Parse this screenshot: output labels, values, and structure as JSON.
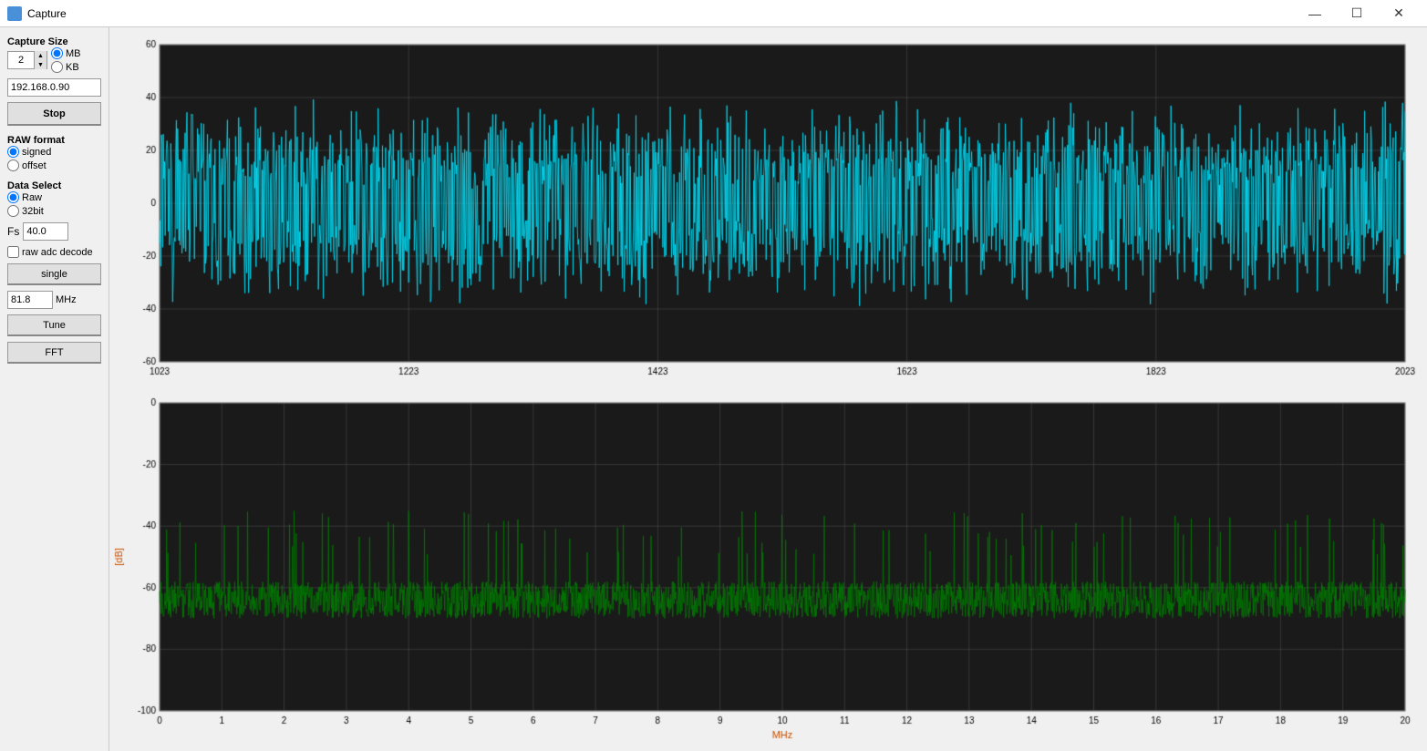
{
  "titleBar": {
    "title": "Capture",
    "icon": "capture-icon",
    "controls": {
      "minimize": "—",
      "maximize": "☐",
      "close": "✕"
    }
  },
  "sidebar": {
    "captureSizeLabel": "Capture Size",
    "captureSizeValue": "2",
    "mbLabel": "MB",
    "kbLabel": "KB",
    "ipValue": "192.168.0.90",
    "stopLabel": "Stop",
    "rawFormatLabel": "RAW format",
    "signedLabel": "signed",
    "offsetLabel": "offset",
    "dataSelectLabel": "Data Select",
    "rawLabel": "Raw",
    "bit32Label": "32bit",
    "fsLabel": "Fs",
    "fsValue": "40.0",
    "rawAdcDecodeLabel": "raw adc decode",
    "singleLabel": "single",
    "freqValue": "81.8",
    "mhzLabel": "MHz",
    "tuneLabel": "Tune",
    "fftLabel": "FFT"
  },
  "topChart": {
    "yMax": 60,
    "yMin": -60,
    "yTicks": [
      60,
      40,
      20,
      0,
      -20,
      -40,
      -60
    ],
    "xStart": 1023,
    "xEnd": 2023,
    "xTicks": [
      1023,
      1223,
      1423,
      1623,
      1823,
      2023
    ],
    "lineColor": "#00e5ff",
    "bgColor": "#1a1a1a",
    "gridColor": "#444"
  },
  "bottomChart": {
    "yMax": 0,
    "yMin": -100,
    "yTicks": [
      0,
      -20,
      -40,
      -60,
      -80,
      -100
    ],
    "xStart": 0,
    "xEnd": 20,
    "xTicks": [
      0,
      1,
      2,
      3,
      4,
      5,
      6,
      7,
      8,
      9,
      10,
      11,
      12,
      13,
      14,
      15,
      16,
      17,
      18,
      19,
      20
    ],
    "xAxisLabel": "MHz",
    "yAxisLabel": "[dB]",
    "lineColor": "#008000",
    "bgColor": "#1a1a1a",
    "gridColor": "#444"
  }
}
